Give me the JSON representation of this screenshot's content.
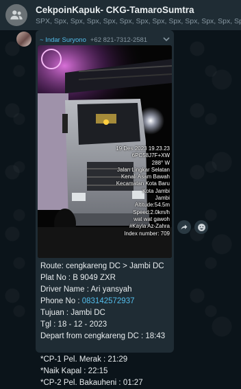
{
  "header": {
    "title": "CekpoinKapuk- CKG-TamaroSumtra",
    "members": "SPX, Spx, Spx, Spx, Spx, Spx, Spx, Spx, Spx, Spx, Spx, Spx, Spx, Spx"
  },
  "message": {
    "sender_name": "~ Indar Suryono",
    "sender_phone": "+62 821-7312-2581",
    "photo_overlay": [
      "19 Des 2023 19.23.23",
      "6PC58J7F+XW",
      "288° W",
      "Jalan Lingkar Selatan",
      "Kenali Asam Bawah",
      "Kecamatan Kota Baru",
      "Kota Jambi",
      "Jambi",
      "Altitude:54.5m",
      "Speed:2.0km/h",
      "wat wat gawoh",
      "#Kayla Az-Zahra",
      "Index number: 709"
    ],
    "caption": {
      "route": "Route: cengkareng DC > Jambi DC",
      "plate": "Plat No : B 9049 ZXR",
      "driver": "Driver Name : Ari yansyah",
      "phone_label": "Phone No : ",
      "phone_number": "083142572937",
      "tujuan": "Tujuan : Jambi DC",
      "tgl": "Tgl : 18 - 12 - 2023",
      "depart": "Depart from cengkareng DC : 18:43",
      "cp1": "*CP-1 Pel. Merak : 21:29",
      "naik": "*Naik Kapal : 22:15",
      "cp2": "*CP-2 Pel. Bakauheni : 01:27"
    }
  },
  "icons": {
    "group_avatar": "group-icon",
    "menu": "chevron-down-icon",
    "share": "share-icon",
    "react": "emoji-icon"
  },
  "colors": {
    "header_bg": "#1f2c34",
    "chat_bg": "#0b141a",
    "bubble_bg": "#1f2c34",
    "link": "#53bdeb",
    "sender_name": "#53bdeb"
  }
}
